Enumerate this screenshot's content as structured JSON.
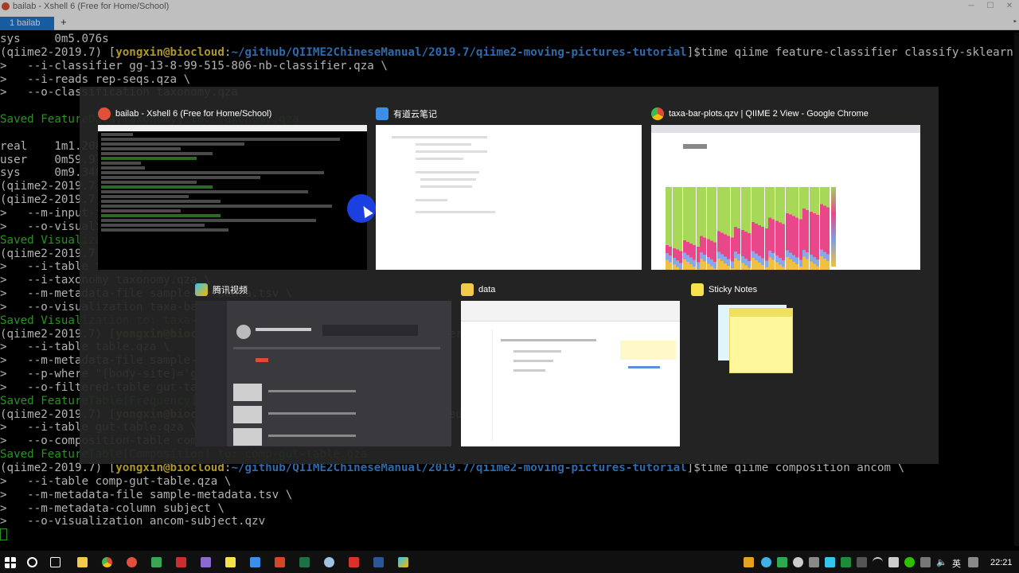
{
  "window": {
    "title": "bailab - Xshell 6 (Free for Home/School)",
    "tab_label": "1 bailab",
    "tab_add": "+"
  },
  "terminal": {
    "lines": [
      {
        "parts": [
          {
            "t": "sys     0m5.076s"
          }
        ]
      },
      {
        "parts": [
          {
            "t": "(qiime2-2019.7) ["
          },
          {
            "t": "yongxin@biocloud",
            "c": "userhost"
          },
          {
            "t": ":"
          },
          {
            "t": "~/github/QIIME2ChineseManual/2019.7/qiime2-moving-pictures-tutorial",
            "c": "path"
          },
          {
            "t": "]$time qiime feature-classifier classify-sklearn \\"
          }
        ]
      },
      {
        "parts": [
          {
            "t": ">   --i-classifier gg-13-8-99-515-806-nb-classifier.qza \\"
          }
        ]
      },
      {
        "parts": [
          {
            "t": ">   --i-reads rep-seqs.qza \\"
          }
        ]
      },
      {
        "parts": [
          {
            "t": ">   --o-classification taxonomy.qza"
          }
        ]
      },
      {
        "parts": [
          {
            "t": ""
          }
        ]
      },
      {
        "parts": [
          {
            "t": "Saved FeatureData[Taxonomy] to: taxonomy.qza",
            "c": "green"
          }
        ]
      },
      {
        "parts": [
          {
            "t": ""
          }
        ]
      },
      {
        "parts": [
          {
            "t": "real    1m1.208s"
          }
        ]
      },
      {
        "parts": [
          {
            "t": "user    0m59.979s"
          }
        ]
      },
      {
        "parts": [
          {
            "t": "sys     0m9.348s"
          }
        ]
      },
      {
        "parts": [
          {
            "t": "(qiime2-2019.7) ["
          },
          {
            "t": "yongxin@biocloud",
            "c": "userhost"
          },
          {
            "t": ":~]$"
          }
        ]
      },
      {
        "parts": [
          {
            "t": "(qiime2-2019.7) ["
          },
          {
            "t": "yongxin@biocloud",
            "c": "userhost"
          },
          {
            "t": ":~]$"
          }
        ]
      },
      {
        "parts": [
          {
            "t": ">   --m-input-file taxonomy.qza \\"
          }
        ]
      },
      {
        "parts": [
          {
            "t": ">   --o-visualization taxonomy.qzv"
          }
        ]
      },
      {
        "parts": [
          {
            "t": "Saved Visualization to: taxonomy.qzv",
            "c": "green"
          }
        ]
      },
      {
        "parts": [
          {
            "t": "(qiime2-2019.7) ["
          },
          {
            "t": "yongxin@biocloud",
            "c": "userhost"
          },
          {
            "t": ":~]$"
          }
        ]
      },
      {
        "parts": [
          {
            "t": ">   --i-table table.qza \\"
          }
        ]
      },
      {
        "parts": [
          {
            "t": ">   --i-taxonomy taxonomy.qza \\"
          }
        ]
      },
      {
        "parts": [
          {
            "t": ">   --m-metadata-file sample-metadata.tsv \\"
          }
        ]
      },
      {
        "parts": [
          {
            "t": ">   --o-visualization taxa-bar-plots.qzv"
          }
        ]
      },
      {
        "parts": [
          {
            "t": "Saved Visualization to: taxa-bar-plots.qzv",
            "c": "green"
          }
        ]
      },
      {
        "parts": [
          {
            "t": "(qiime2-2019.7) ["
          },
          {
            "t": "yongxin@biocloud",
            "c": "userhost"
          },
          {
            "t": ":~]$time qiime feature-table filter-samples \\"
          }
        ]
      },
      {
        "parts": [
          {
            "t": ">   --i-table table.qza \\"
          }
        ]
      },
      {
        "parts": [
          {
            "t": ">   --m-metadata-file sample-metadata.tsv \\"
          }
        ]
      },
      {
        "parts": [
          {
            "t": ">   --p-where \"[body-site]='gut'\" \\"
          }
        ]
      },
      {
        "parts": [
          {
            "t": ">   --o-filtered-table gut-table.qza"
          }
        ]
      },
      {
        "parts": [
          {
            "t": "Saved FeatureTable[Frequency] to: gut-table.qza",
            "c": "green"
          }
        ]
      },
      {
        "parts": [
          {
            "t": "(qiime2-2019.7) ["
          },
          {
            "t": "yongxin@biocloud",
            "c": "userhost"
          },
          {
            "t": ":~]$time qiime composition add-pseudocount \\"
          }
        ]
      },
      {
        "parts": [
          {
            "t": ">   --i-table gut-table.qza \\"
          }
        ]
      },
      {
        "parts": [
          {
            "t": ">   --o-composition-table comp-gut-table.qza"
          }
        ]
      },
      {
        "parts": [
          {
            "t": "Saved FeatureTable[Composition] to: comp-gut-table.qza",
            "c": "green"
          }
        ]
      },
      {
        "parts": [
          {
            "t": "(qiime2-2019.7) ["
          },
          {
            "t": "yongxin@biocloud",
            "c": "userhost"
          },
          {
            "t": ":"
          },
          {
            "t": "~/github/QIIME2ChineseManual/2019.7/qiime2-moving-pictures-tutorial",
            "c": "path"
          },
          {
            "t": "]$time qiime composition ancom \\"
          }
        ]
      },
      {
        "parts": [
          {
            "t": ">   --i-table comp-gut-table.qza \\"
          }
        ]
      },
      {
        "parts": [
          {
            "t": ">   --m-metadata-file sample-metadata.tsv \\"
          }
        ]
      },
      {
        "parts": [
          {
            "t": ">   --m-metadata-column subject \\"
          }
        ]
      },
      {
        "parts": [
          {
            "t": ">   --o-visualization ancom-subject.qzv"
          }
        ]
      }
    ]
  },
  "switcher": {
    "windows": [
      {
        "title": "bailab - Xshell 6 (Free for Home/School)",
        "icon": "xshell-icon",
        "color": "#e0503a"
      },
      {
        "title": "有道云笔记",
        "icon": "youdao-note-icon",
        "color": "#3b8fe8"
      },
      {
        "title": "taxa-bar-plots.qzv | QIIME 2 View - Google Chrome",
        "icon": "chrome-icon",
        "color": "#dd4b39"
      },
      {
        "title": "腾讯视频",
        "icon": "tencent-video-icon",
        "color": "#37c3f0"
      },
      {
        "title": "data",
        "icon": "folder-icon",
        "color": "#f3c94b"
      },
      {
        "title": "Sticky Notes",
        "icon": "sticky-notes-icon",
        "color": "#f6e24a"
      }
    ]
  },
  "taskbar": {
    "ime": "英",
    "time": "22:21"
  },
  "colors": {
    "prompt_user": "#e8c93a",
    "prompt_path": "#3d8ee6",
    "saved_green": "#35c62a",
    "tab_blue": "#1f7ad6"
  }
}
